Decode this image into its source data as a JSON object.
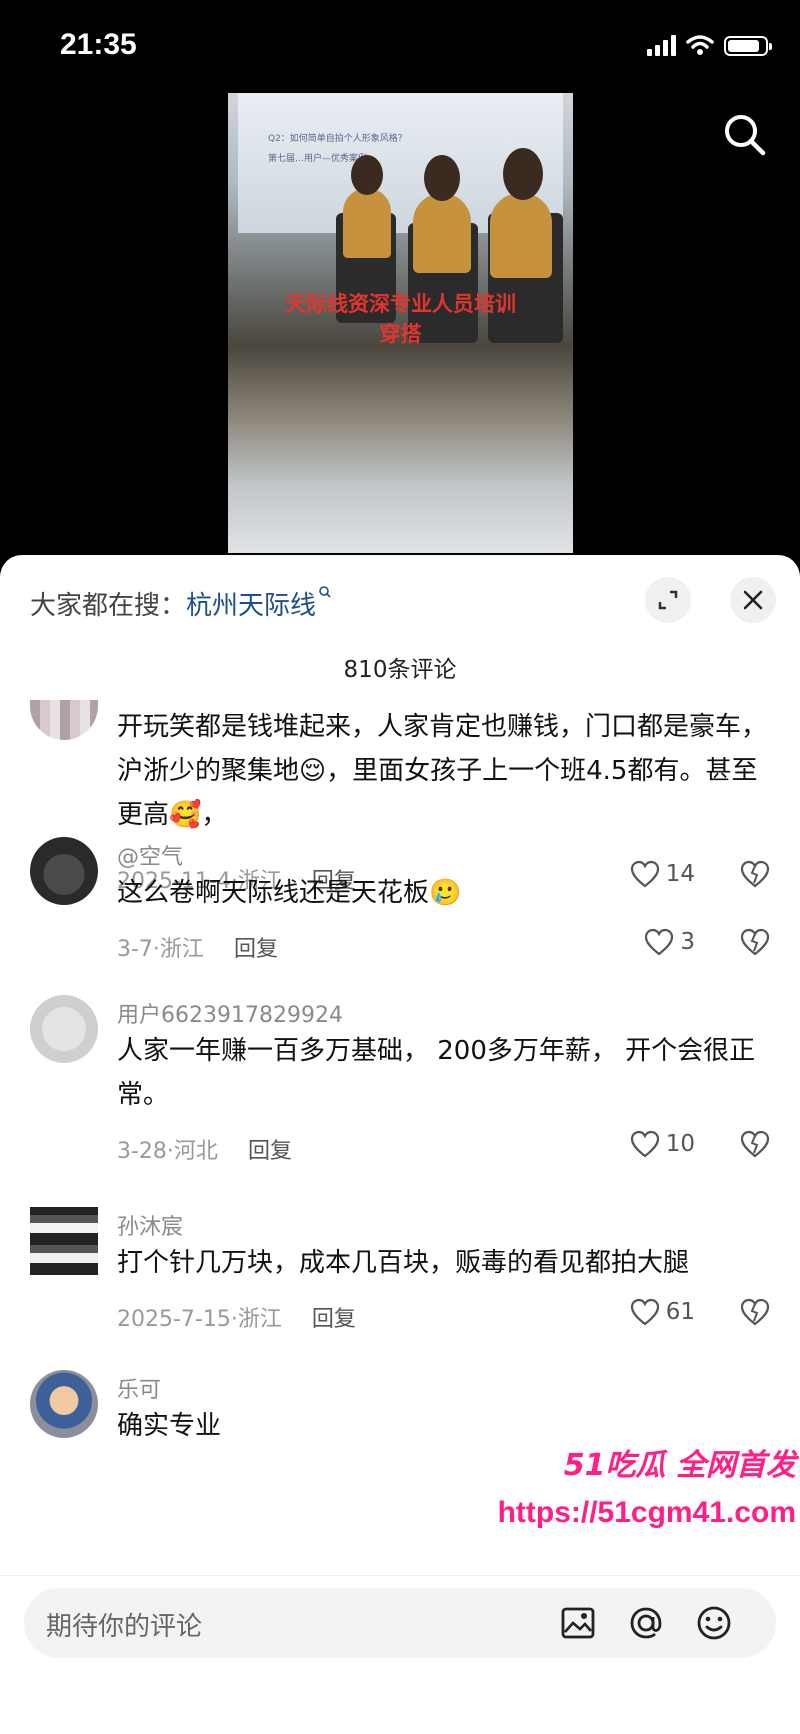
{
  "status_bar": {
    "time": "21:35",
    "battery_level": 0.85
  },
  "video": {
    "screen_lines": [
      "Q2：如何简单自拍个人形象风格？",
      "第七届…用户—优秀案例"
    ],
    "overlay_line1": "天际线资深专业人员培训",
    "overlay_line2": "穿搭"
  },
  "search": {
    "prefix": "大家都在搜：",
    "keyword": "杭州天际线"
  },
  "comments_count_label": "810条评论",
  "comments": [
    {
      "username": "",
      "text": "开玩笑都是钱堆起来，人家肯定也赚钱，门口都是豪车，沪浙少的聚集地😌，里面女孩子上一个班4.5都有。甚至更高🥰，",
      "date_location": "2025-11-4·浙江",
      "reply_label": "回复",
      "likes": "14"
    },
    {
      "username": "@空气",
      "text": "这么卷啊天际线还是天花板🥲",
      "date_location": "3-7·浙江",
      "reply_label": "回复",
      "likes": "3"
    },
    {
      "username": "用户6623917829924",
      "text": "人家一年赚一百多万基础， 200多万年薪， 开个会很正常。",
      "date_location": "3-28·河北",
      "reply_label": "回复",
      "likes": "10"
    },
    {
      "username": "孙沐宸",
      "text": "打个针几万块，成本几百块，贩毒的看见都拍大腿",
      "date_location": "2025-7-15·浙江",
      "reply_label": "回复",
      "likes": "61"
    },
    {
      "username": "乐可",
      "text": "确实专业",
      "date_location": "",
      "reply_label": "",
      "likes": ""
    }
  ],
  "watermark": {
    "line1": "51吃瓜 全网首发",
    "line2": "https://51cgm41.com"
  },
  "input": {
    "placeholder": "期待你的评论"
  },
  "icons": [
    "search-icon",
    "expand-icon",
    "close-icon",
    "heart-icon",
    "dislike-icon",
    "image-icon",
    "at-icon",
    "emoji-icon"
  ]
}
